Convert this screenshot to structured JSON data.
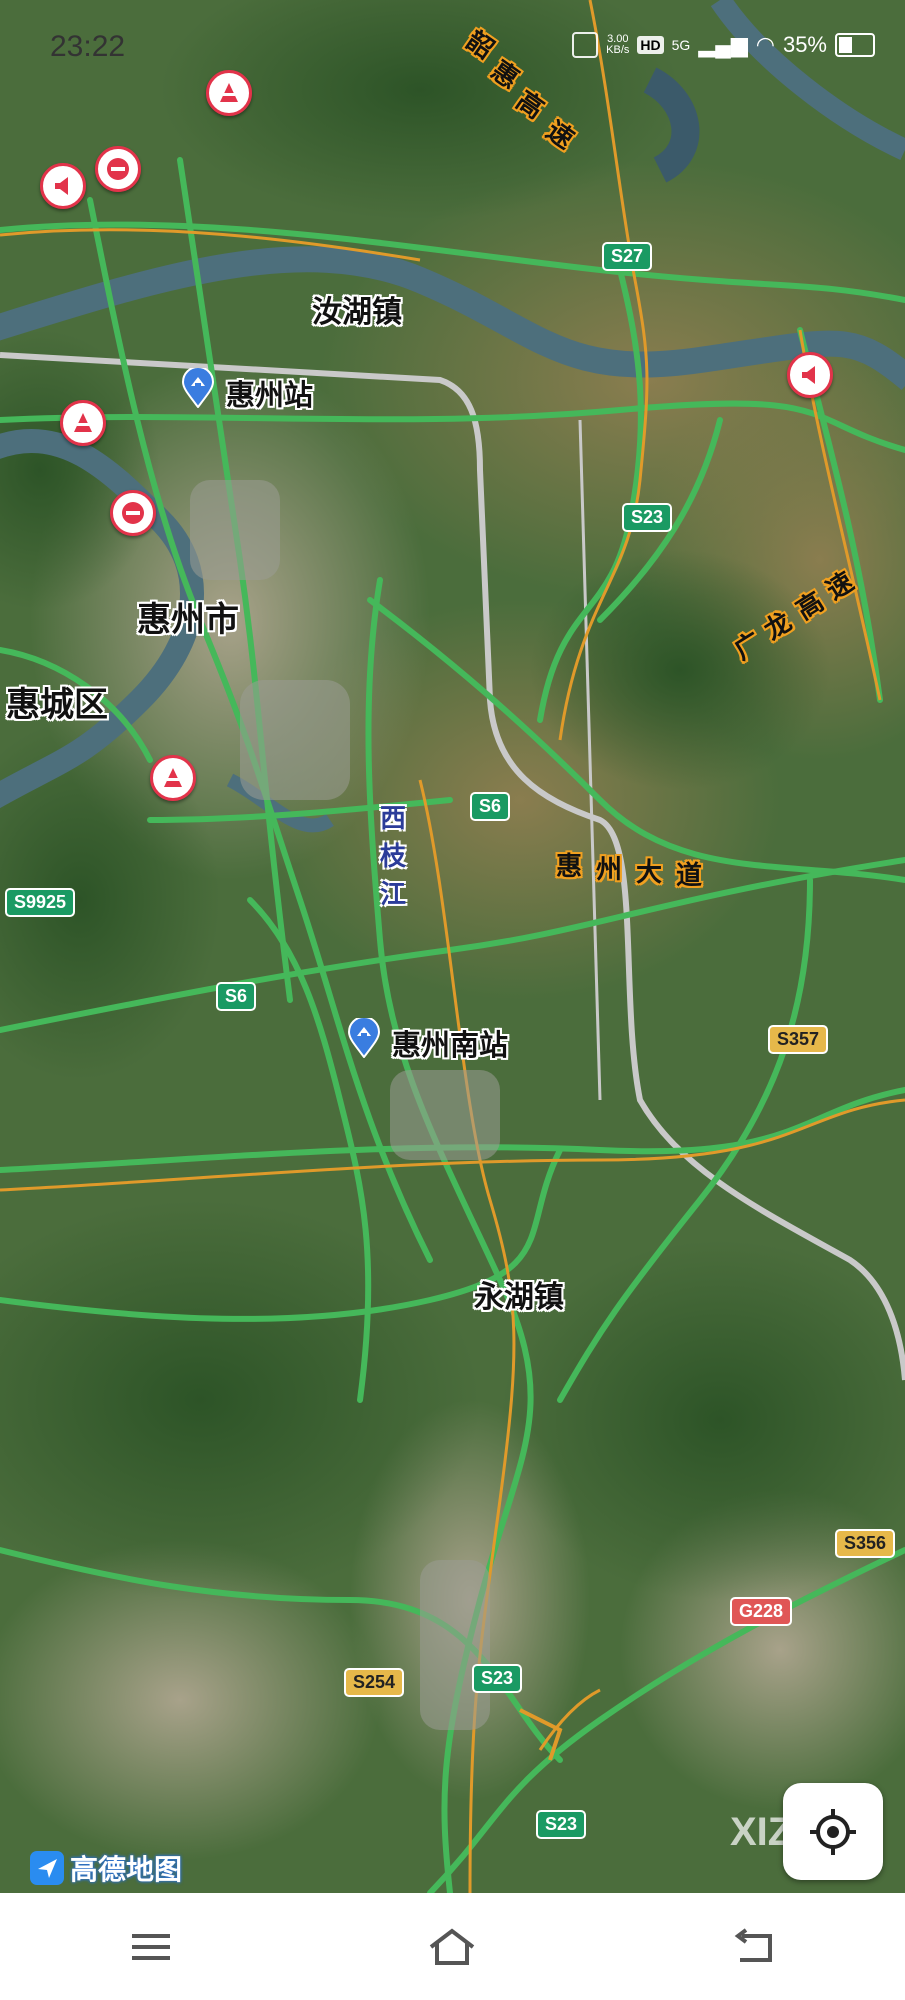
{
  "status_bar": {
    "time": "23:22",
    "speed_value": "3.00",
    "speed_unit": "KB/s",
    "hd": "HD",
    "network": "5G",
    "battery": "35%"
  },
  "places": {
    "ruhu": "汝湖镇",
    "huizhou_station": "惠州站",
    "huizhou_city": "惠州市",
    "huicheng": "惠城区",
    "huizhou_south": "惠州南站",
    "yonghu": "永湖镇",
    "xizhi_river": [
      "西",
      "枝",
      "江"
    ]
  },
  "roads": {
    "shaohui": [
      "韶",
      "惠",
      "高",
      "速"
    ],
    "guanglong": [
      "广",
      "龙",
      "高",
      "速"
    ],
    "huizhou_dadao": [
      "惠",
      "州",
      "大",
      "道"
    ]
  },
  "shields": {
    "s27": "S27",
    "s23_top": "S23",
    "s6_east": "S6",
    "s9925": "S9925",
    "s6_west": "S6",
    "s357": "S357",
    "s356": "S356",
    "g228": "G228",
    "s254": "S254",
    "s23_mid": "S23",
    "s23_bottom": "S23"
  },
  "brand": {
    "logo_text": "高德地图",
    "watermark": "XIZI"
  },
  "colors": {
    "road_green": "#45b85a",
    "road_orange": "#e09a2a",
    "rail_gray": "#c9c9c9",
    "river": "#4d6f7c",
    "marker_red": "#e2334a",
    "station_blue": "#3a7de0"
  }
}
